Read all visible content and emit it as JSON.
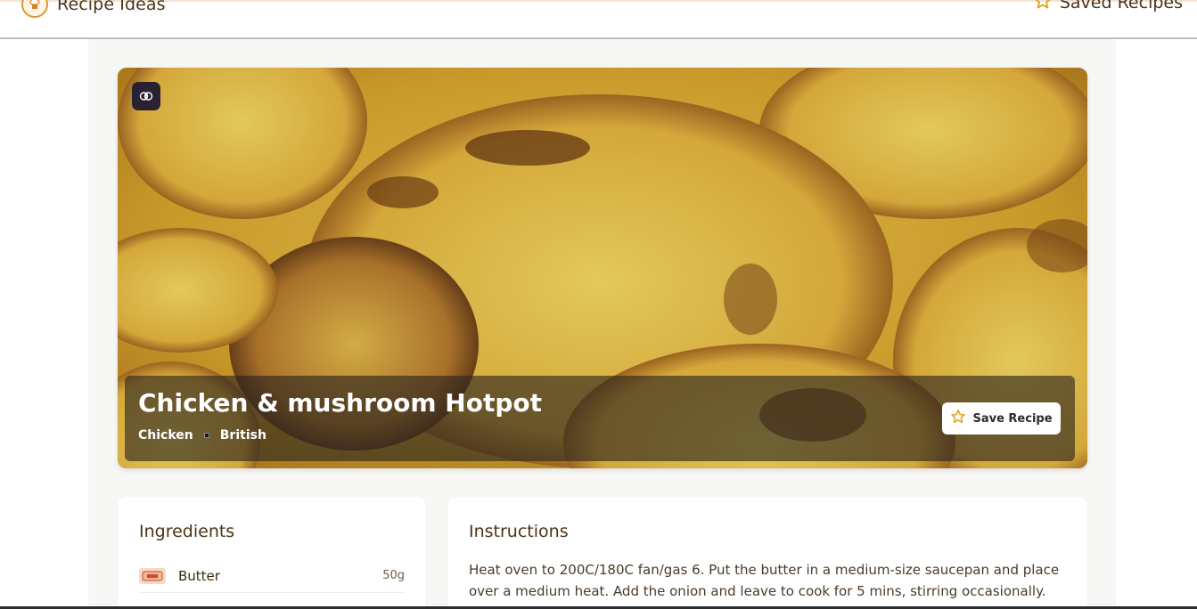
{
  "header": {
    "brand_title": "Recipe Ideas",
    "logo_icon": "chef-logo-icon",
    "saved_label": "Saved Recipes",
    "saved_icon": "star-icon"
  },
  "hero": {
    "badge_icon": "brain-icon",
    "title": "Chicken & mushroom Hotpot",
    "category": "Chicken",
    "area": "British",
    "save_label": "Save Recipe",
    "save_icon": "star-outline-icon"
  },
  "ingredients": {
    "heading": "Ingredients",
    "items": [
      {
        "name": "Butter",
        "qty": "50g"
      }
    ]
  },
  "instructions": {
    "heading": "Instructions",
    "text": "Heat oven to 200C/180C fan/gas 6. Put the butter in a medium-size saucepan and place over a medium heat. Add the onion and leave to cook for 5 mins, stirring occasionally. Add the"
  },
  "colors": {
    "accent_star": "#e3a21a",
    "brand_text": "#4a3418"
  }
}
